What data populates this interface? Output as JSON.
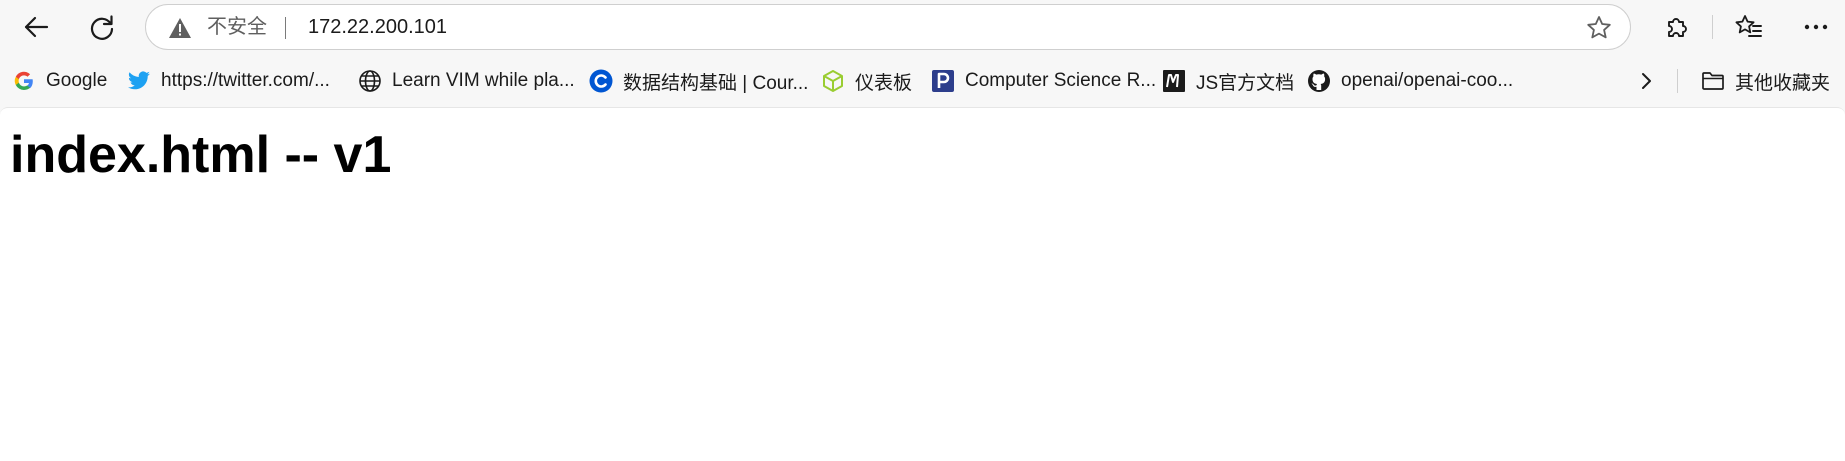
{
  "browser": {
    "address_bar": {
      "security_label": "不安全",
      "url": "172.22.200.101"
    },
    "bookmarks": [
      {
        "label": "Google",
        "icon": "google-icon"
      },
      {
        "label": "https://twitter.com/...",
        "icon": "twitter-icon"
      },
      {
        "label": "Learn VIM while pla...",
        "icon": "globe-icon"
      },
      {
        "label": "数据结构基础 | Cour...",
        "icon": "coursera-icon"
      },
      {
        "label": "仪表板",
        "icon": "cube-icon"
      },
      {
        "label": "Computer Science R...",
        "icon": "p-icon"
      },
      {
        "label": "JS官方文档",
        "icon": "m-icon"
      },
      {
        "label": "openai/openai-coo...",
        "icon": "github-icon"
      }
    ],
    "other_bookmarks": "其他收藏夹"
  },
  "page": {
    "heading": "index.html -- v1"
  }
}
